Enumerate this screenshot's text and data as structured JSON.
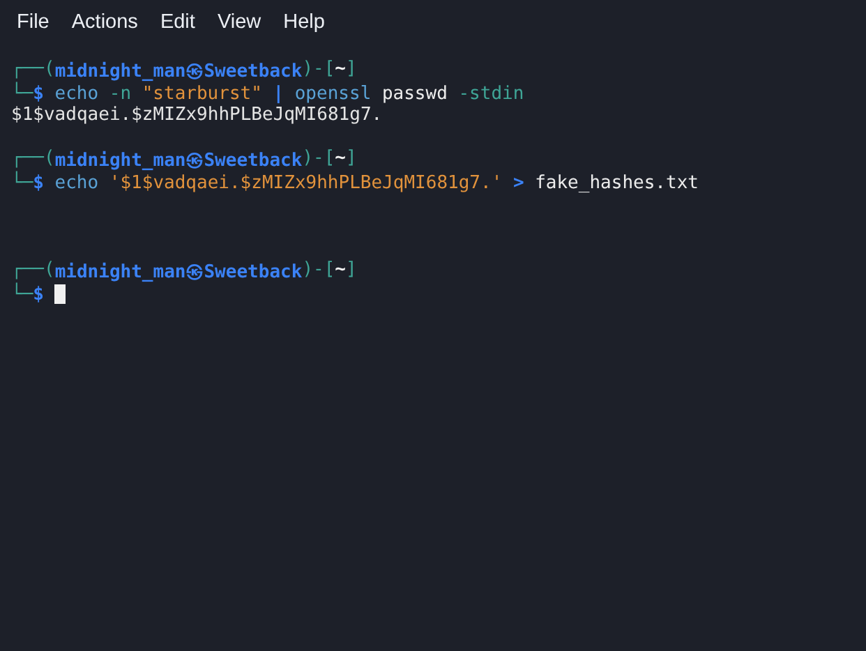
{
  "menu": [
    {
      "label": "File"
    },
    {
      "label": "Actions"
    },
    {
      "label": "Edit"
    },
    {
      "label": "View"
    },
    {
      "label": "Help"
    }
  ],
  "blocks": [
    {
      "prompt": [
        {
          "kind": "frame",
          "text": "┌──("
        },
        {
          "kind": "user",
          "text": "midnight_man㉿Sweetback"
        },
        {
          "kind": "frame",
          "text": ")-["
        },
        {
          "kind": "dir",
          "text": "~"
        },
        {
          "kind": "frame",
          "text": "]"
        }
      ],
      "corner": "└─",
      "sign": "$",
      "command": [
        {
          "kind": "cmd",
          "text": "echo"
        },
        {
          "kind": "flag",
          "text": "-n"
        },
        {
          "kind": "string",
          "text": "\"starburst\""
        },
        {
          "kind": "op",
          "text": "|"
        },
        {
          "kind": "cmd",
          "text": "openssl"
        },
        {
          "kind": "arg",
          "text": "passwd"
        },
        {
          "kind": "flag",
          "text": "-stdin"
        }
      ],
      "output": "$1$vadqaei.$zMIZx9hhPLBeJqMI681g7.",
      "cursor": false
    },
    {
      "prompt": [
        {
          "kind": "frame",
          "text": "┌──("
        },
        {
          "kind": "user",
          "text": "midnight_man㉿Sweetback"
        },
        {
          "kind": "frame",
          "text": ")-["
        },
        {
          "kind": "dir",
          "text": "~"
        },
        {
          "kind": "frame",
          "text": "]"
        }
      ],
      "corner": "└─",
      "sign": "$",
      "command": [
        {
          "kind": "cmd",
          "text": "echo"
        },
        {
          "kind": "string",
          "text": "'$1$vadqaei.$zMIZx9hhPLBeJqMI681g7.'"
        },
        {
          "kind": "op",
          "text": ">"
        },
        {
          "kind": "arg",
          "text": "fake_hashes.txt"
        }
      ],
      "cursor": false
    },
    {
      "prompt": [
        {
          "kind": "frame",
          "text": "┌──("
        },
        {
          "kind": "user",
          "text": "midnight_man㉿Sweetback"
        },
        {
          "kind": "frame",
          "text": ")-["
        },
        {
          "kind": "dir",
          "text": "~"
        },
        {
          "kind": "frame",
          "text": "]"
        }
      ],
      "corner": "└─",
      "sign": "$",
      "cursor": true
    }
  ]
}
